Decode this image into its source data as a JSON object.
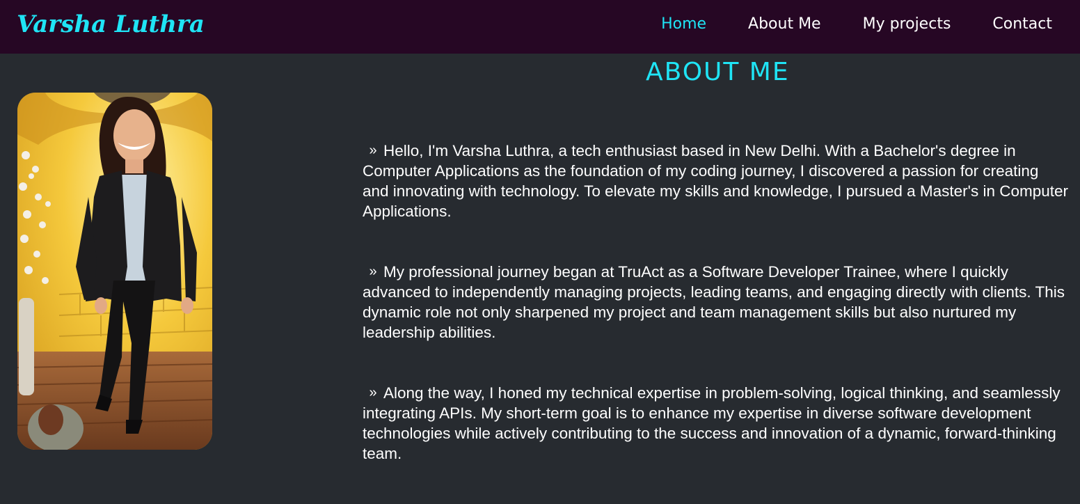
{
  "header": {
    "logo": "Varsha Luthra",
    "nav": [
      {
        "label": "Home"
      },
      {
        "label": "About Me"
      },
      {
        "label": "My projects"
      },
      {
        "label": "Contact"
      }
    ]
  },
  "main": {
    "title": "ABOUT ME",
    "bullet_glyph": "»",
    "paragraphs": [
      "Hello, I'm Varsha Luthra, a tech enthusiast based in New Delhi. With a Bachelor's degree in Computer Applications as the foundation of my coding journey, I discovered a passion for creating and innovating with technology. To elevate my skills and knowledge, I pursued a Master's in Computer Applications.",
      "My professional journey began at TruAct as a Software Developer Trainee, where I quickly advanced to independently managing projects, leading teams, and engaging directly with clients. This dynamic role not only sharpened my project and team management skills but also nurtured my leadership abilities.",
      "Along the way, I honed my technical expertise in problem-solving, logical thinking, and seamlessly integrating APIs. My short-term goal is to enhance my expertise in diverse software development technologies while actively contributing to the success and innovation of a dynamic, forward-thinking team."
    ]
  },
  "colors": {
    "accent": "#1fe4f5",
    "navbar_bg": "#260724",
    "page_bg": "#272b30",
    "text": "#ffffff"
  }
}
